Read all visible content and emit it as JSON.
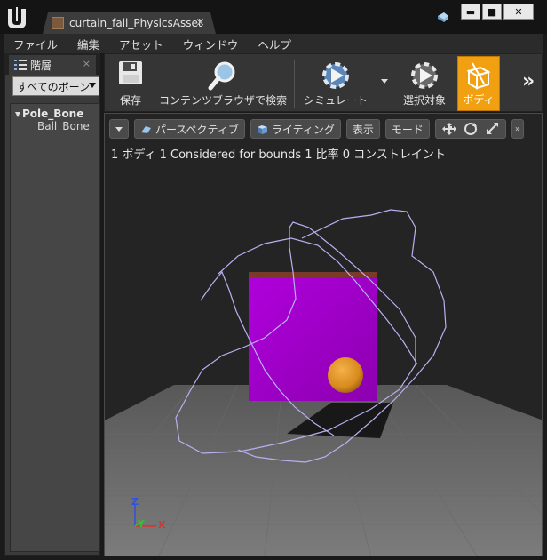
{
  "window": {
    "tab_title": "curtain_fail_PhysicsAsset",
    "tab_close": "×",
    "minimize": "▬",
    "maximize": "■",
    "close": "✕"
  },
  "menu": [
    "ファイル",
    "編集",
    "アセット",
    "ウィンドウ",
    "ヘルプ"
  ],
  "left_panel": {
    "tab_label": "階層",
    "tab_close": "×",
    "bone_filter": "すべてのボーン",
    "tree": {
      "root": "Pole_Bone",
      "child": "Ball_Bone"
    }
  },
  "toolbar": {
    "save": "保存",
    "browse": "コンテンツブラウザで検索",
    "simulate": "シミュレート",
    "selected": "選択対象",
    "body": "ボディ",
    "more": "»"
  },
  "viewport": {
    "perspective": "パースペクティブ",
    "lighting": "ライティング",
    "show": "表示",
    "mode": "モード",
    "more": "»",
    "stats": "1 ボディ 1 Considered for bounds 1 比率 0 コンストレイント",
    "axes": {
      "z": "Z",
      "y": "Y",
      "x": "X"
    }
  },
  "colors": {
    "accent": "#f0a010",
    "cube": "#a000c8",
    "sphere": "#e8921e",
    "bounds_wire": "#b8b0f0",
    "axis_x": "#e03030",
    "axis_y": "#30c030",
    "axis_z": "#3050e0"
  }
}
